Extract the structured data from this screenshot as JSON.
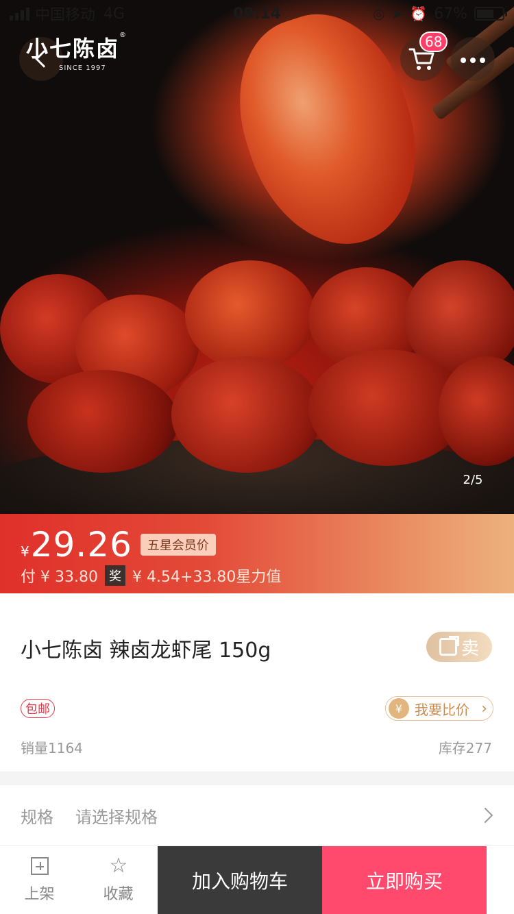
{
  "status_bar": {
    "carrier": "中国移动",
    "network": "4G",
    "time": "09:14",
    "battery": "67%",
    "battery_level": 0.67
  },
  "header": {
    "brand": "小七陈卤",
    "brand_mark": "®",
    "brand_since": "SINCE 1997",
    "cart_count": "68"
  },
  "gallery": {
    "pager": "2/5"
  },
  "price": {
    "currency": "¥",
    "amount": "29.26",
    "member_tag": "五星会员价",
    "pay_text": "付 ¥ 33.80",
    "reward_tag": "奖",
    "reward_text": "¥ 4.54+33.80星力值"
  },
  "product": {
    "title": "小七陈卤 辣卤龙虾尾 150g",
    "share_label": "卖",
    "free_shipping": "包邮",
    "compare_currency": "¥",
    "compare_label": "我要比价",
    "sales": "销量1164",
    "stock": "库存277"
  },
  "spec": {
    "label": "规格",
    "value": "请选择规格"
  },
  "bottom_bar": {
    "list_label": "上架",
    "favorite_label": "收藏",
    "add_to_cart": "加入购物车",
    "buy_now": "立即购买"
  },
  "colors": {
    "price_gradient_start": "#e0302a",
    "price_gradient_end": "#edb17e",
    "buy_now": "#ff4a6e",
    "add_to_cart": "#3a3a3a",
    "badge": "#ff3f6a"
  },
  "icons": {
    "back": "chevron-left-icon",
    "cart": "cart-icon",
    "more": "more-dots-icon",
    "share": "share-icon",
    "compare": "yen-icon",
    "spec": "chevron-right-icon",
    "list": "plus-square-icon",
    "favorite": "star-icon"
  }
}
